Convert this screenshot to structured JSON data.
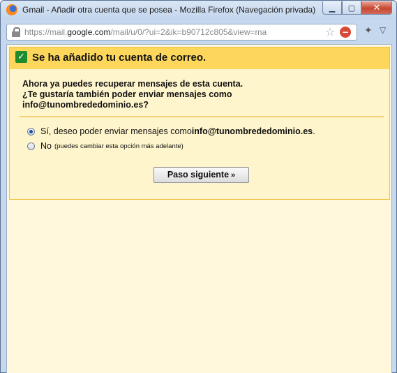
{
  "window": {
    "title": "Gmail - Añadir otra cuenta que se posea - Mozilla Firefox (Navegación privada)",
    "minimize": "▁",
    "maximize": "▢",
    "close": "✕"
  },
  "urlbar": {
    "prefix": "https://mail.",
    "domain": "google.com",
    "path": "/mail/u/0/?ui=2&ik=b90712c805&view=ma"
  },
  "icons": {
    "app": "firefox-icon",
    "lock": "lock-icon",
    "bookmark": "star-icon",
    "stop": "stop-icon",
    "addon": "addon-icon",
    "menu": "chevron-down-icon",
    "check": "check-icon"
  },
  "dialog": {
    "title": "Se ha añadido tu cuenta de correo.",
    "intro_lines": [
      "Ahora ya puedes recuperar mensajes de esta cuenta.",
      "¿Te gustaría también poder enviar mensajes como",
      "info@tunombrededominio.es?"
    ],
    "option_yes_text": "Sí, deseo poder enviar mensajes como ",
    "option_yes_email": "info@tunombrededominio.es",
    "option_yes_suffix": ".",
    "option_no_label": "No",
    "option_no_note": "(puedes cambiar esta opción más adelante)",
    "selected_option": "yes",
    "next_button": "Paso siguiente",
    "next_chevron": "»"
  },
  "colors": {
    "header_bg": "#fdd75c",
    "dialog_bg": "#fff5cc",
    "check_green": "#1e8c2e"
  }
}
